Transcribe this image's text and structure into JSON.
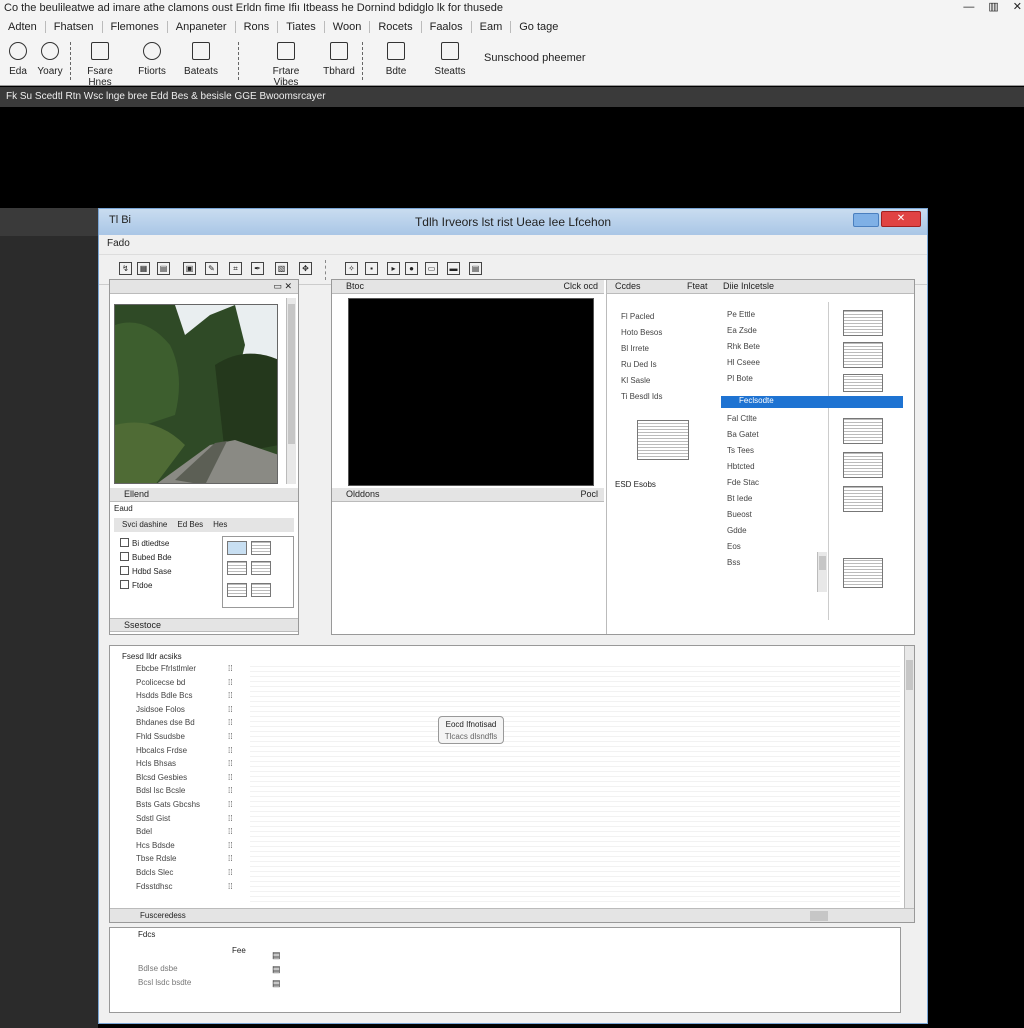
{
  "app": {
    "title": "Co the beulileatwe ad imare athe clamons oust Erldn fime Ifiı Itbeass he Dornind bdidglo lk for thusede",
    "menu": [
      "Adten",
      "Fhatsen",
      "Flemones",
      "Anpaneter",
      "Rons",
      "Tiates",
      "Woon",
      "Rocets",
      "Faalos",
      "Eam",
      "Go tage"
    ],
    "toolbar": [
      {
        "label": "Eda",
        "icon": "circle-icon"
      },
      {
        "label": "Yoary",
        "icon": "circle-icon"
      },
      {
        "label": "Fsare Hnes",
        "icon": "grid-icon"
      },
      {
        "label": "Ftiorts",
        "icon": "gear-icon"
      },
      {
        "label": "Bateats",
        "icon": "image-icon"
      },
      {
        "label": "Frtare Vibes",
        "icon": "monitor-icon"
      },
      {
        "label": "Tbhard",
        "icon": "layers-icon"
      },
      {
        "label": "Bdte",
        "icon": "crop-icon"
      },
      {
        "label": "Steatts",
        "icon": "file-icon"
      }
    ],
    "toolbar_status": "Sunschood pheemer",
    "path": "Fk  Su  Scedtl Rtn  Wsc lnge  bree  Edd  Bes  & besisle  GGE Bwoomsrcayer"
  },
  "window": {
    "title": "Tdlh Irveors lst rist Ueae Iee Lfcehon",
    "icon_label": "Tl  Bi",
    "menu": "Fado",
    "left_panel": {
      "top_label": "",
      "bottom_label": "Ellend",
      "search_label": "Eaud",
      "tab_labels": [
        "Svci dashine",
        "Ed Bes",
        "Hes"
      ],
      "tree": [
        "Bi dtiedtse",
        "Bubed Bde",
        "Hdbd Sase",
        "Ftdoe"
      ],
      "footer": "Ssestoce"
    },
    "viewer": {
      "title": "Btoc",
      "right_tag": "Clck ocd",
      "bottom_label": "Olddons",
      "bottom_right": "Pocl"
    },
    "asset_panel": {
      "header_left": "Ccdes",
      "header_mid": "Fteat",
      "header_right": "Diie Inlcetsle",
      "left_list": [
        "Fl Pacled",
        "Hoto Besos",
        "Bl Irrete",
        "Ru Ded Is",
        "Kl Sasle",
        "Ti Besdl Ids"
      ],
      "right_list": [
        "Pe Ettle",
        "Ea Zsde",
        "Rhk Bete",
        "Hl Cseee",
        "Pl Bote",
        "Feclsodte",
        "Fal Ctlte",
        "Ba Gatet",
        "Ts Tees",
        "Hbtcted",
        "Fde Stac",
        "Bt Iede",
        "Bueost",
        "Gdde",
        "Eos",
        "Bss"
      ],
      "bottom_label": "ESD  Esobs",
      "highlight_color": "#1e73d2"
    },
    "property_grid": {
      "header": "Fsesd Ildr acsiks",
      "rows": [
        "Ebcbe Ffrlstlmler",
        "Pcolicecse bd",
        "Hsdds Bdle Bcs",
        "Jsidsoe Folos",
        "Bhdanes dse Bd",
        "Fhld Ssudsbe",
        "Hbcalcs Frdse",
        "Hcls Bhsas",
        "Blcsd Gesbies",
        "Bdsl lsc Bcsle",
        "Bsts Gats Gbcshs",
        "Sdstl Gist",
        "Bdel",
        "Hcs Bdsde",
        "Tbse Rdsle",
        "Bdcls Slec",
        "Fdsstdhsc"
      ],
      "footer": "Fusceredess",
      "button_label": "Eocd Ifnotisad",
      "button_sub": "Tlcacs dlsndfls"
    },
    "bottom_panel": {
      "header": "Fdcs",
      "col_label": "Fee",
      "rows": [
        "Bdlse dsbe",
        "Bcsl lsdc bsdte"
      ]
    }
  }
}
